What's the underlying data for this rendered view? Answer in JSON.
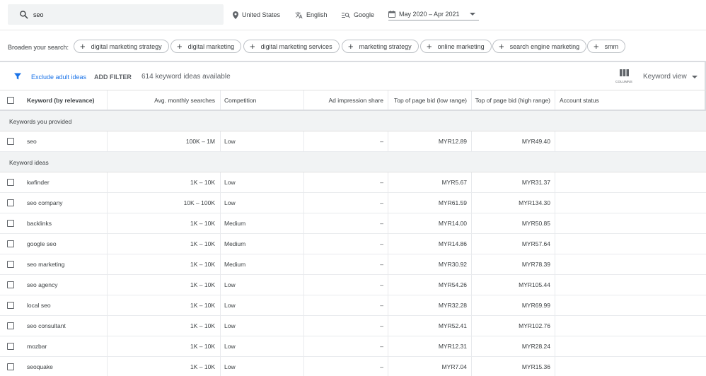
{
  "search": {
    "value": "seo",
    "placeholder": ""
  },
  "top": {
    "location": "United States",
    "language": "English",
    "network": "Google",
    "date_range": "May 2020 – Apr 2021"
  },
  "broaden": {
    "label": "Broaden your search:",
    "chips": [
      "digital marketing strategy",
      "digital marketing",
      "digital marketing services",
      "marketing strategy",
      "online marketing",
      "search engine marketing",
      "smm"
    ]
  },
  "filter": {
    "exclude_adult": "Exclude adult ideas",
    "add_filter": "ADD FILTER",
    "count_text": "614 keyword ideas available",
    "columns_label": "COLUMNS",
    "view_label": "Keyword view"
  },
  "table": {
    "headers": {
      "keyword": "Keyword (by relevance)",
      "avg": "Avg. monthly searches",
      "competition": "Competition",
      "impression": "Ad impression share",
      "bid_low": "Top of page bid (low range)",
      "bid_high": "Top of page bid (high range)",
      "account": "Account status"
    },
    "section_provided": "Keywords you provided",
    "provided": [
      {
        "keyword": "seo",
        "avg": "100K – 1M",
        "competition": "Low",
        "impression": "–",
        "bid_low": "MYR12.89",
        "bid_high": "MYR49.40",
        "account": ""
      }
    ],
    "section_ideas": "Keyword ideas",
    "ideas": [
      {
        "keyword": "kwfinder",
        "avg": "1K – 10K",
        "competition": "Low",
        "impression": "–",
        "bid_low": "MYR5.67",
        "bid_high": "MYR31.37",
        "account": ""
      },
      {
        "keyword": "seo company",
        "avg": "10K – 100K",
        "competition": "Low",
        "impression": "–",
        "bid_low": "MYR61.59",
        "bid_high": "MYR134.30",
        "account": ""
      },
      {
        "keyword": "backlinks",
        "avg": "1K – 10K",
        "competition": "Medium",
        "impression": "–",
        "bid_low": "MYR14.00",
        "bid_high": "MYR50.85",
        "account": ""
      },
      {
        "keyword": "google seo",
        "avg": "1K – 10K",
        "competition": "Medium",
        "impression": "–",
        "bid_low": "MYR14.86",
        "bid_high": "MYR57.64",
        "account": ""
      },
      {
        "keyword": "seo marketing",
        "avg": "1K – 10K",
        "competition": "Medium",
        "impression": "–",
        "bid_low": "MYR30.92",
        "bid_high": "MYR78.39",
        "account": ""
      },
      {
        "keyword": "seo agency",
        "avg": "1K – 10K",
        "competition": "Low",
        "impression": "–",
        "bid_low": "MYR54.26",
        "bid_high": "MYR105.44",
        "account": ""
      },
      {
        "keyword": "local seo",
        "avg": "1K – 10K",
        "competition": "Low",
        "impression": "–",
        "bid_low": "MYR32.28",
        "bid_high": "MYR69.99",
        "account": ""
      },
      {
        "keyword": "seo consultant",
        "avg": "1K – 10K",
        "competition": "Low",
        "impression": "–",
        "bid_low": "MYR52.41",
        "bid_high": "MYR102.76",
        "account": ""
      },
      {
        "keyword": "mozbar",
        "avg": "1K – 10K",
        "competition": "Low",
        "impression": "–",
        "bid_low": "MYR12.31",
        "bid_high": "MYR28.24",
        "account": ""
      },
      {
        "keyword": "seoquake",
        "avg": "1K – 10K",
        "competition": "Low",
        "impression": "–",
        "bid_low": "MYR7.04",
        "bid_high": "MYR15.36",
        "account": ""
      }
    ]
  },
  "colors": {
    "accent": "#1a73e8",
    "section_bg": "#f1f3f4"
  },
  "icons": {
    "search": "search-icon",
    "location": "location-pin-icon",
    "language": "translate-icon",
    "network": "search-network-icon",
    "date": "calendar-icon",
    "filter": "filter-icon",
    "columns": "columns-icon"
  }
}
